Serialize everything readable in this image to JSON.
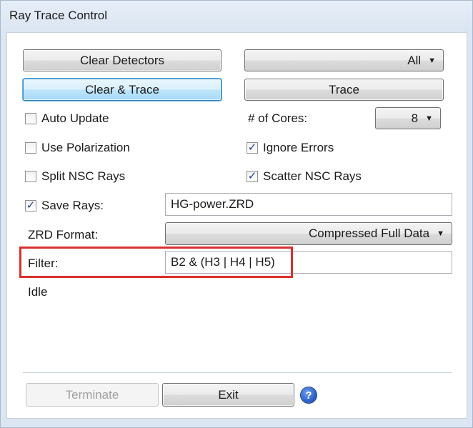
{
  "window": {
    "title": "Ray Trace Control"
  },
  "buttons": {
    "clear_detectors": "Clear Detectors",
    "clear_trace": "Clear & Trace",
    "trace": "Trace",
    "terminate": "Terminate",
    "exit": "Exit"
  },
  "detector_select": {
    "value": "All"
  },
  "cores": {
    "label": "# of Cores:",
    "value": "8"
  },
  "options": {
    "auto_update": {
      "label": "Auto Update",
      "checked": false
    },
    "use_polarization": {
      "label": "Use Polarization",
      "checked": false
    },
    "split_nsc_rays": {
      "label": "Split NSC Rays",
      "checked": false
    },
    "ignore_errors": {
      "label": "Ignore Errors",
      "checked": true
    },
    "scatter_nsc_rays": {
      "label": "Scatter NSC Rays",
      "checked": true
    },
    "save_rays": {
      "label": "Save Rays:",
      "checked": true
    }
  },
  "save_rays_file": {
    "value": "HG-power.ZRD"
  },
  "zrd_format": {
    "label": "ZRD Format:",
    "value": "Compressed Full Data"
  },
  "filter": {
    "label": "Filter:",
    "value": "B2 & (H3 | H4 | H5)"
  },
  "status": {
    "text": "Idle"
  },
  "help": {
    "glyph": "?"
  },
  "colors": {
    "highlight": "#d8302c",
    "focus_accent": "#3c7fb1"
  },
  "icons": {
    "checked": "checkmark-icon",
    "dropdown": "chevron-down-icon",
    "help": "help-icon"
  }
}
